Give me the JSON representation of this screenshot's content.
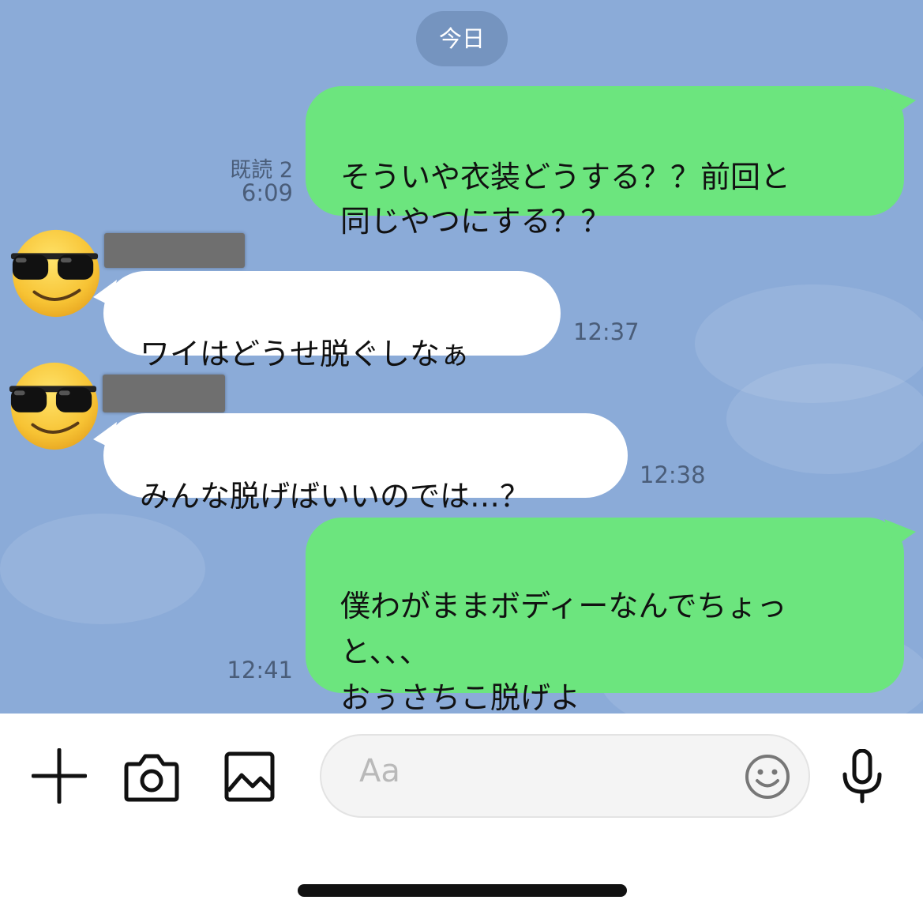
{
  "chat": {
    "date_label": "今日",
    "messages": [
      {
        "side": "me",
        "text": "そういや衣装どうする？？前回と\n同じやつにする？？",
        "read_receipt": "既読 2",
        "time": "6:09"
      },
      {
        "side": "them",
        "avatar_icon": "smiling-face-with-sunglasses-icon",
        "sender_name_redacted": true,
        "text": "ワイはどうせ脱ぐしなぁ",
        "time": "12:37"
      },
      {
        "side": "them",
        "avatar_icon": "smiling-face-with-sunglasses-icon",
        "sender_name_redacted": true,
        "text": "みんな脱げばいいのでは…？",
        "time": "12:38"
      },
      {
        "side": "me",
        "text": "僕わがままボディーなんでちょっ\nと、、、\nおぅさちこ脱げよ",
        "time": "12:41"
      }
    ]
  },
  "input_bar": {
    "icons": [
      "plus-icon",
      "camera-icon",
      "image-icon",
      "emoji-icon",
      "microphone-icon"
    ],
    "placeholder": "Aa"
  },
  "colors": {
    "chat_background": "#8babd8",
    "my_bubble": "#6ce57e",
    "their_bubble": "#ffffff",
    "date_pill": "#7594bf"
  }
}
